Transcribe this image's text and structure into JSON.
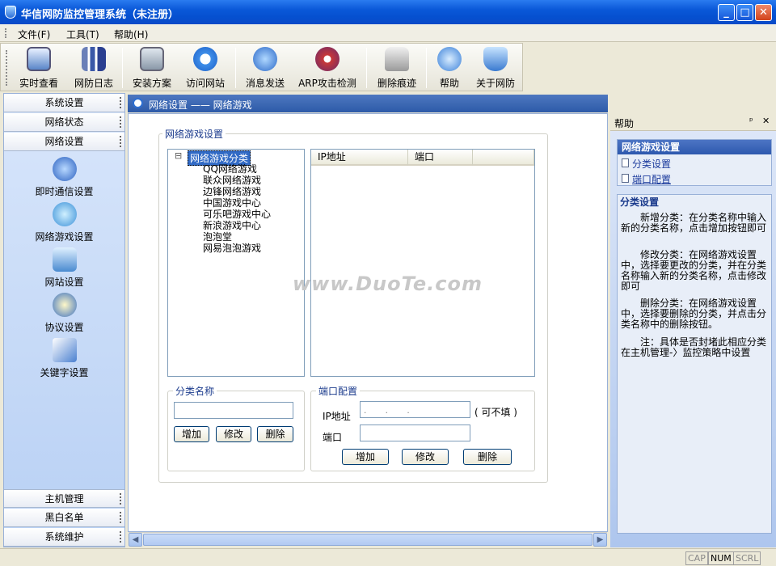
{
  "window": {
    "title": "华信网防监控管理系统（未注册）",
    "controls": {
      "minimize": "_",
      "maximize": "□",
      "close": "✕"
    }
  },
  "menu": [
    "文件(F)",
    "工具(T)",
    "帮助(H)"
  ],
  "toolbar": {
    "items": [
      {
        "label": "实时查看",
        "icon": "monitor-eye-icon"
      },
      {
        "label": "网防日志",
        "icon": "bar-chart-icon"
      },
      {
        "label": "安装方案",
        "icon": "computer-network-icon"
      },
      {
        "label": "访问网站",
        "icon": "ie-browser-icon"
      },
      {
        "label": "消息发送",
        "icon": "message-send-icon"
      },
      {
        "label": "ARP攻击检测",
        "icon": "arp-detect-icon"
      },
      {
        "label": "删除痕迹",
        "icon": "eraser-icon"
      },
      {
        "label": "帮助",
        "icon": "help-icon"
      },
      {
        "label": "关于网防",
        "icon": "shield-info-icon"
      }
    ]
  },
  "sidebar": {
    "top_sections": [
      "系统设置",
      "网络状态",
      "网络设置"
    ],
    "items": [
      {
        "label": "即时通信设置",
        "icon": "im-users-icon"
      },
      {
        "label": "网络游戏设置",
        "icon": "game-face-icon"
      },
      {
        "label": "网站设置",
        "icon": "website-icon"
      },
      {
        "label": "协议设置",
        "icon": "protocol-star-icon"
      },
      {
        "label": "关键字设置",
        "icon": "keyword-document-icon"
      }
    ],
    "bottom_sections": [
      "主机管理",
      "黑白名单",
      "系统维护"
    ]
  },
  "main": {
    "header": "网络设置 —— 网络游戏",
    "group_title": "网络游戏设置",
    "tree": {
      "root": "网络游戏分类",
      "children": [
        "QQ网络游戏",
        "联众网络游戏",
        "边锋网络游戏",
        "中国游戏中心",
        "可乐吧游戏中心",
        "新浪游戏中心",
        "泡泡堂",
        "网易泡泡游戏"
      ]
    },
    "list_columns": [
      "IP地址",
      "端口"
    ],
    "category": {
      "title": "分类名称",
      "input_value": "",
      "add": "增加",
      "edit": "修改",
      "delete": "删除"
    },
    "port_config": {
      "title": "端口配置",
      "ip_label": "IP地址",
      "ip_value": ".       .       .",
      "ip_note": "( 可不填 )",
      "port_label": "端口",
      "port_value": "",
      "add": "增加",
      "edit": "修改",
      "delete": "删除"
    },
    "watermark": "www.DuoTe.com"
  },
  "help": {
    "title": "帮助",
    "pin": "ᵖ",
    "close": "✕",
    "box_title": "网络游戏设置",
    "links": [
      "分类设置",
      "端口配置"
    ],
    "section_title": "分类设置",
    "paragraphs": [
      "　　新增分类：在分类名称中输入新的分类名称，点击增加按钮即可",
      "　　修改分类：在网络游戏设置中，选择要更改的分类，并在分类名称输入新的分类名称，点击修改即可",
      "　　删除分类：在网络游戏设置中，选择要删除的分类，并点击分类名称中的删除按钮。",
      "　　注：具体是否封堵此相应分类在主机管理-〉监控策略中设置"
    ]
  },
  "status": {
    "cap": "CAP",
    "num": "NUM",
    "scrl": "SCRL"
  },
  "colors": {
    "titlebar": "#0a58d8",
    "panel_header": "#2d5aa8",
    "tree_select": "#316ac5"
  }
}
